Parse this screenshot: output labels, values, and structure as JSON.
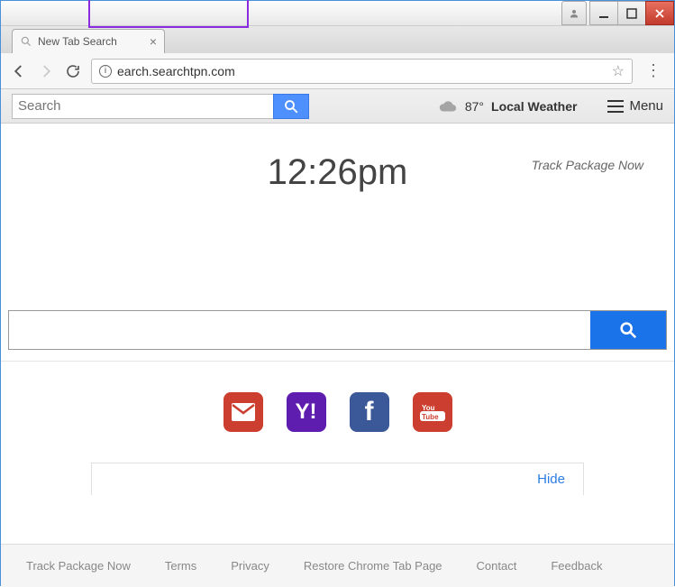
{
  "window": {
    "tab_title": "New Tab Search"
  },
  "toolbar": {
    "url": "earch.searchtpn.com"
  },
  "page_toolbar": {
    "search_placeholder": "Search",
    "weather_temp": "87°",
    "weather_label": "Local Weather",
    "menu_label": "Menu"
  },
  "clock": {
    "time": "12:26pm",
    "track_link": "Track Package Now"
  },
  "big_search": {
    "value": ""
  },
  "quick_icons": [
    {
      "name": "gmail-icon"
    },
    {
      "name": "yahoo-icon"
    },
    {
      "name": "facebook-icon"
    },
    {
      "name": "youtube-icon"
    }
  ],
  "hide_panel": {
    "label": "Hide"
  },
  "footer": {
    "links": [
      "Track Package Now",
      "Terms",
      "Privacy",
      "Restore Chrome Tab Page",
      "Contact",
      "Feedback"
    ]
  }
}
